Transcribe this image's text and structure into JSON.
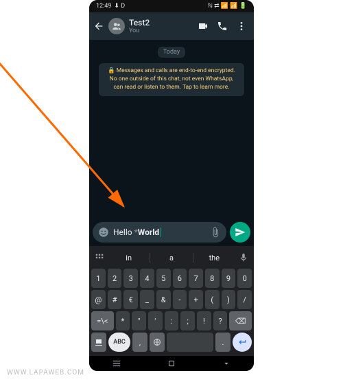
{
  "statusbar": {
    "time": "12:49",
    "indicators_left": "⬇ D",
    "indicators_right": "ℕ ⇄ 📶 📶 🔋"
  },
  "header": {
    "chat_name": "Test2",
    "subtitle": "You"
  },
  "chat": {
    "day_label": "Today",
    "encryption_notice": "🔒 Messages and calls are end-to-end encrypted. No one outside of this chat, not even WhatsApp, can read or listen to them. Tap to learn more."
  },
  "composer": {
    "text_plain": "Hello ",
    "text_bold": "World",
    "formatting_marker": "*"
  },
  "keyboard": {
    "suggestions": [
      "in",
      "a",
      "the"
    ],
    "row1": [
      "1",
      "2",
      "3",
      "4",
      "5",
      "6",
      "7",
      "8",
      "9",
      "0"
    ],
    "row2": [
      "@",
      "#",
      "€",
      "_",
      "&",
      "-",
      "+",
      "(",
      ")",
      "/"
    ],
    "row3_shift": "=\\<",
    "row3": [
      "*",
      "\"",
      "'",
      ":",
      ";",
      "!",
      "?"
    ],
    "row3_back": "⌫",
    "row4_abc": "ABC",
    "row4_comma": ",",
    "row4_lang": "⊕",
    "row4_space": ".",
    "row4_dot": ".",
    "row4_enter": "↵"
  },
  "watermark": "WWW.LAPAWEB.COM"
}
